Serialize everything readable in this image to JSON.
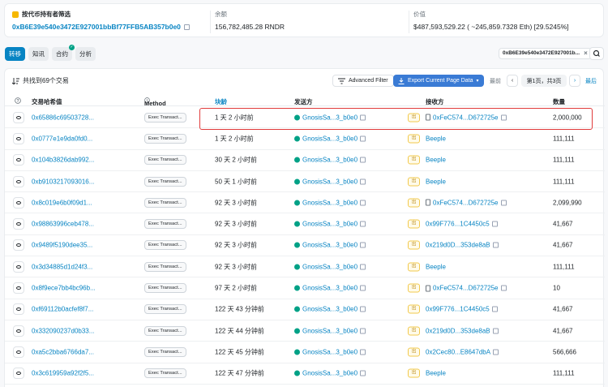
{
  "header": {
    "filter_label": "按代币持有者筛选",
    "filter_address": "0xB6E39e540e3472E927001bbBf77FFB5AB357b0e0",
    "balance_label": "余额",
    "balance_value": "156,782,485.28 RNDR",
    "value_label": "价值",
    "value_value": "$487,593,529.22 ( ~245,859.7328 Eth) [29.5245%]"
  },
  "tabs": [
    "转移",
    "知讯",
    "合约",
    "分析"
  ],
  "active_filter": "0xB6E39e540e3472E927001b...",
  "toolbar": {
    "total": "共找到69个交易",
    "advanced_filter": "Advanced Filter",
    "export": "Export Current Page Data",
    "first": "最前",
    "page_info": "第1页，共3页",
    "last": "最后"
  },
  "columns": {
    "hash": "交易哈希值",
    "method": "Method",
    "age": "块龄",
    "from": "发送方",
    "to": "接收方",
    "qty": "数量"
  },
  "rows": [
    {
      "hash": "0x65886c69503728...",
      "method": "Exec Transact...",
      "age": "1 天 2 小时前",
      "from": "GnosisSa...3_b0e0",
      "dir": "出",
      "to": "0xFeC574...D672725e",
      "to_doc": true,
      "qty": "2,000,000"
    },
    {
      "hash": "0x0777e1e9da0fd0...",
      "method": "Exec Transact...",
      "age": "1 天 2 小时前",
      "from": "GnosisSa...3_b0e0",
      "dir": "出",
      "to": "Beeple",
      "to_doc": false,
      "qty": "111,111"
    },
    {
      "hash": "0x104b3826dab992...",
      "method": "Exec Transact...",
      "age": "30 天 2 小时前",
      "from": "GnosisSa...3_b0e0",
      "dir": "出",
      "to": "Beeple",
      "to_doc": false,
      "qty": "111,111"
    },
    {
      "hash": "0xb9103217093016...",
      "method": "Exec Transact...",
      "age": "50 天 1 小时前",
      "from": "GnosisSa...3_b0e0",
      "dir": "出",
      "to": "Beeple",
      "to_doc": false,
      "qty": "111,111"
    },
    {
      "hash": "0x8c019e6b0f09d1...",
      "method": "Exec Transact...",
      "age": "92 天 3 小时前",
      "from": "GnosisSa...3_b0e0",
      "dir": "出",
      "to": "0xFeC574...D672725e",
      "to_doc": true,
      "qty": "2,099,990"
    },
    {
      "hash": "0x98863996ceb478...",
      "method": "Exec Transact...",
      "age": "92 天 3 小时前",
      "from": "GnosisSa...3_b0e0",
      "dir": "出",
      "to": "0x99F776...1C4450c5",
      "to_doc": false,
      "qty": "41,667"
    },
    {
      "hash": "0x9489f5190dee35...",
      "method": "Exec Transact...",
      "age": "92 天 3 小时前",
      "from": "GnosisSa...3_b0e0",
      "dir": "出",
      "to": "0x219d0D...353de8aB",
      "to_doc": false,
      "qty": "41,667"
    },
    {
      "hash": "0x3d34885d1d24f3...",
      "method": "Exec Transact...",
      "age": "92 天 3 小时前",
      "from": "GnosisSa...3_b0e0",
      "dir": "出",
      "to": "Beeple",
      "to_doc": false,
      "qty": "111,111"
    },
    {
      "hash": "0x8f9ece7bb4bc96b...",
      "method": "Exec Transact...",
      "age": "97 天 2 小时前",
      "from": "GnosisSa...3_b0e0",
      "dir": "出",
      "to": "0xFeC574...D672725e",
      "to_doc": true,
      "qty": "10"
    },
    {
      "hash": "0xf69112b0acfef8f7...",
      "method": "Exec Transact...",
      "age": "122 天 43 分钟前",
      "from": "GnosisSa...3_b0e0",
      "dir": "出",
      "to": "0x99F776...1C4450c5",
      "to_doc": false,
      "qty": "41,667"
    },
    {
      "hash": "0x332090237d0b33...",
      "method": "Exec Transact...",
      "age": "122 天 44 分钟前",
      "from": "GnosisSa...3_b0e0",
      "dir": "出",
      "to": "0x219d0D...353de8aB",
      "to_doc": false,
      "qty": "41,667"
    },
    {
      "hash": "0xa5c2bba6766da7...",
      "method": "Exec Transact...",
      "age": "122 天 45 分钟前",
      "from": "GnosisSa...3_b0e0",
      "dir": "出",
      "to": "0x2Cec80...E8647dbA",
      "to_doc": false,
      "qty": "566,666"
    },
    {
      "hash": "0x3c619959a92f2f5...",
      "method": "Exec Transact...",
      "age": "122 天 47 分钟前",
      "from": "GnosisSa...3_b0e0",
      "dir": "出",
      "to": "Beeple",
      "to_doc": false,
      "qty": "111,111"
    }
  ],
  "colors": {
    "link": "#0784c3",
    "highlight_border": "#e03b3b",
    "export_button": "#3a7bd5"
  }
}
